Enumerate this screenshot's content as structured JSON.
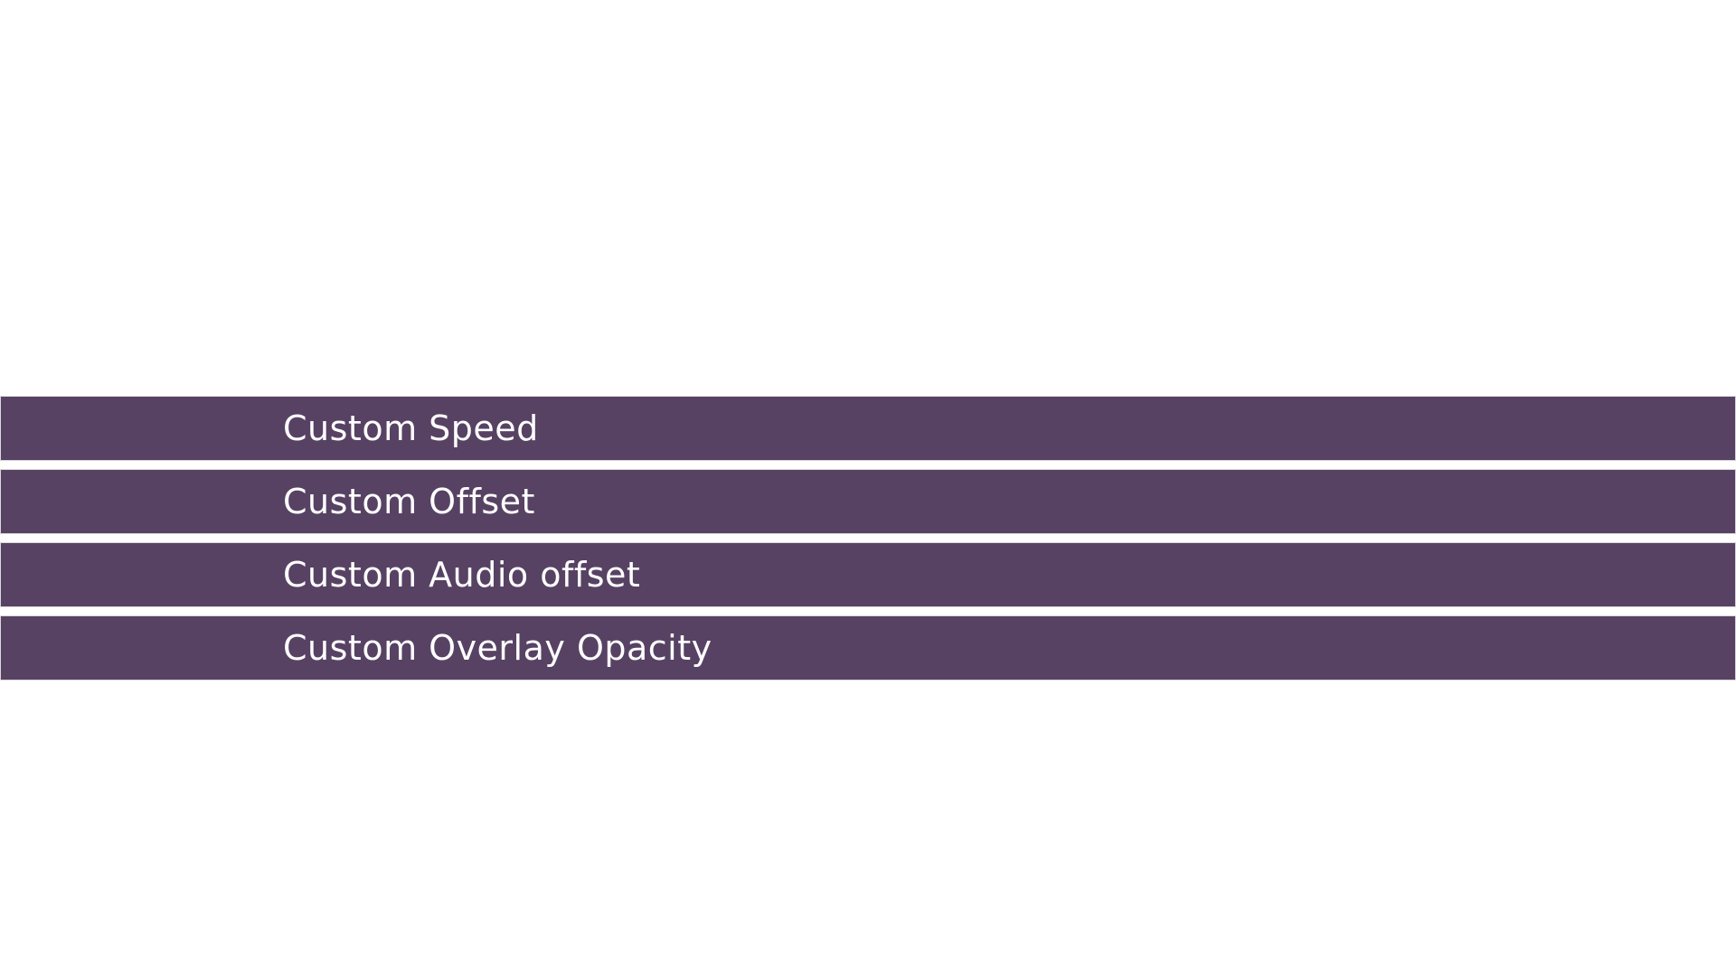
{
  "theme": {
    "item_background": "#574264",
    "item_text": "#ffffff",
    "page_background": "#ffffff"
  },
  "menu": {
    "items": [
      {
        "label": "Custom Speed"
      },
      {
        "label": "Custom Offset"
      },
      {
        "label": "Custom Audio offset"
      },
      {
        "label": "Custom Overlay Opacity"
      }
    ]
  }
}
